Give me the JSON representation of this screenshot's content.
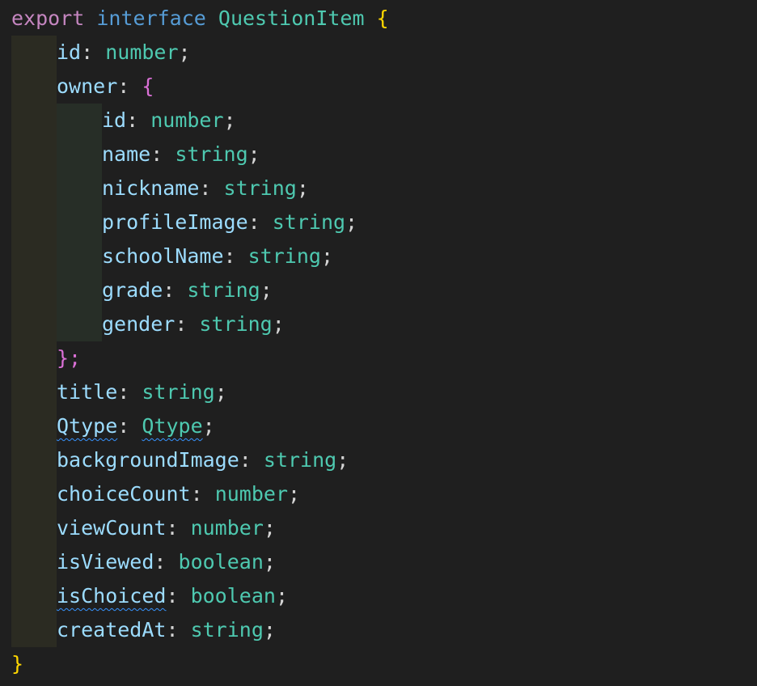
{
  "editor": {
    "header": {
      "export_kw": "export",
      "interface_kw": "interface",
      "name": "QuestionItem",
      "open_brace": "{"
    },
    "closing_brace": "}",
    "owner_close": "};",
    "lines": [
      {
        "prop": "id",
        "type": "number"
      },
      {
        "prop": "owner",
        "type": "{"
      },
      {
        "prop": "id",
        "type": "number"
      },
      {
        "prop": "name",
        "type": "string"
      },
      {
        "prop": "nickname",
        "type": "string"
      },
      {
        "prop": "profileImage",
        "type": "string"
      },
      {
        "prop": "schoolName",
        "type": "string"
      },
      {
        "prop": "grade",
        "type": "string"
      },
      {
        "prop": "gender",
        "type": "string"
      },
      {
        "prop": "title",
        "type": "string"
      },
      {
        "prop": "Qtype",
        "type": "Qtype"
      },
      {
        "prop": "backgroundImage",
        "type": "string"
      },
      {
        "prop": "choiceCount",
        "type": "number"
      },
      {
        "prop": "viewCount",
        "type": "number"
      },
      {
        "prop": "isViewed",
        "type": "boolean"
      },
      {
        "prop": "isChoiced",
        "type": "boolean"
      },
      {
        "prop": "createdAt",
        "type": "string"
      }
    ],
    "colors": {
      "background": "#1f1f1f",
      "keyword_export": "#c586c0",
      "keyword_interface": "#569cd6",
      "type": "#4ec9b0",
      "property": "#9cdcfe",
      "bracket_level1": "#ffd700",
      "bracket_level2": "#da70d6",
      "indent_guide_1": "#2b2b22",
      "indent_guide_2": "#272e27",
      "squiggle": "#3794ff"
    }
  }
}
